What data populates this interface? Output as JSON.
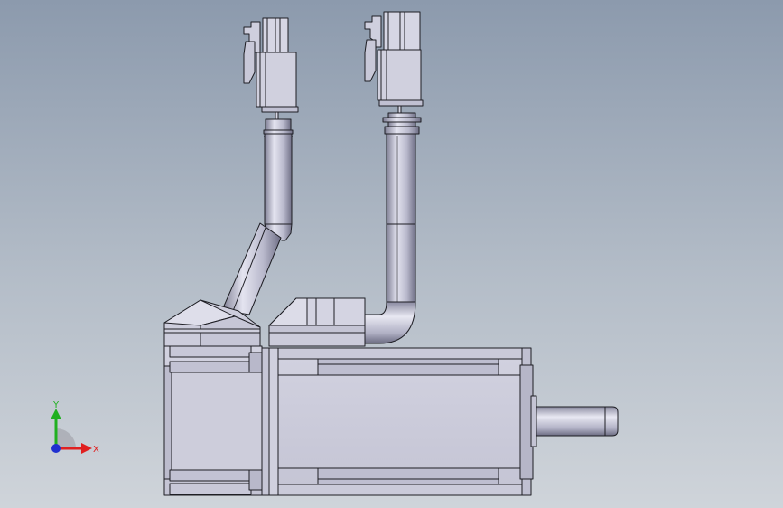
{
  "viewport": {
    "background_top": "#8c9aad",
    "background_bottom": "#cfd4da",
    "model_color": "#c9c9d9",
    "edge_color": "#1e1e24"
  },
  "axis_triad": {
    "x_label": "X",
    "y_label": "Y",
    "x_color": "#e02020",
    "y_color": "#20b020",
    "z_color": "#2030d0"
  }
}
